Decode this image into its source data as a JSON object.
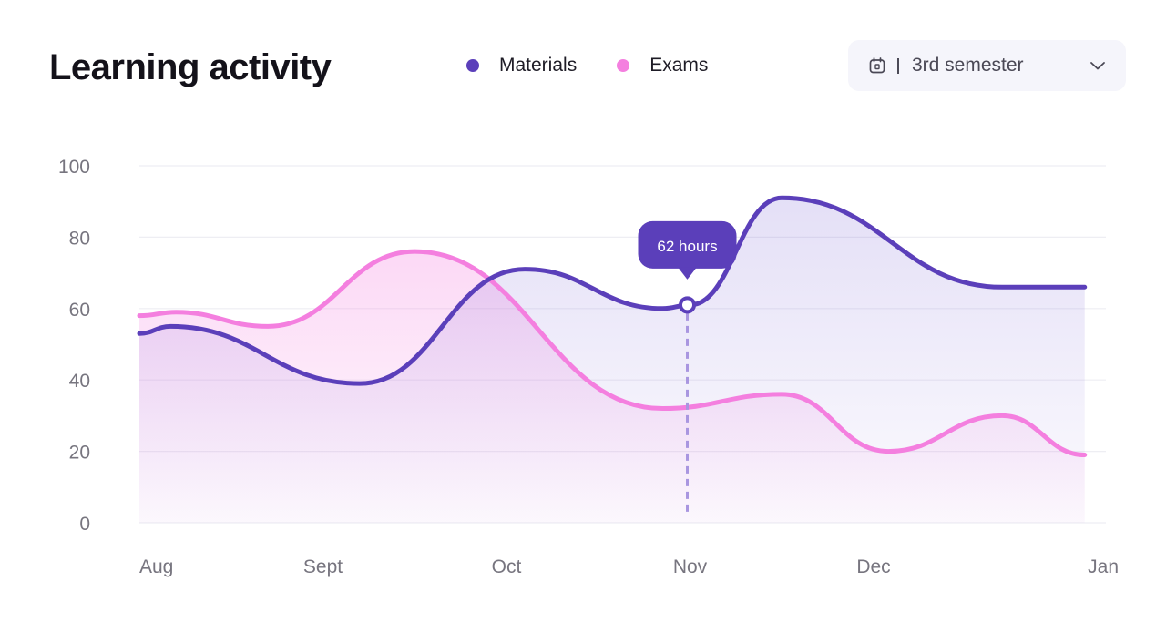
{
  "header": {
    "title": "Learning activity",
    "semester_select": {
      "value": "3rd semester",
      "icon": "calendar-icon",
      "dropdown_icon": "chevron-down-icon"
    }
  },
  "colors": {
    "materials": "#5b3fba",
    "exams": "#f47fdf",
    "grid": "#eeeef3",
    "axis_text": "#77757f"
  },
  "chart_data": {
    "type": "area",
    "x": [
      "Aug",
      "Sept",
      "Oct",
      "Nov",
      "Dec",
      "Jan"
    ],
    "ylim": [
      0,
      100
    ],
    "yticks": [
      0,
      20,
      40,
      60,
      80,
      100
    ],
    "grid": true,
    "legend": "top",
    "series": [
      {
        "name": "Materials",
        "color": "#5b3fba",
        "points": [
          [
            0,
            53
          ],
          [
            0.17,
            55
          ],
          [
            1.2,
            39
          ],
          [
            2.1,
            71
          ],
          [
            2.85,
            60
          ],
          [
            3.0,
            61
          ],
          [
            3.5,
            91
          ],
          [
            4.7,
            66
          ],
          [
            5.15,
            66
          ]
        ]
      },
      {
        "name": "Exams",
        "color": "#f47fdf",
        "points": [
          [
            0,
            58
          ],
          [
            0.2,
            59
          ],
          [
            0.7,
            55
          ],
          [
            1.5,
            76
          ],
          [
            2.85,
            32
          ],
          [
            3.5,
            36
          ],
          [
            4.08,
            20
          ],
          [
            4.7,
            30
          ],
          [
            5.15,
            19
          ]
        ]
      }
    ],
    "annotations": [
      {
        "series": "Materials",
        "x": "Nov",
        "y": 61,
        "label": "62 hours"
      }
    ]
  }
}
